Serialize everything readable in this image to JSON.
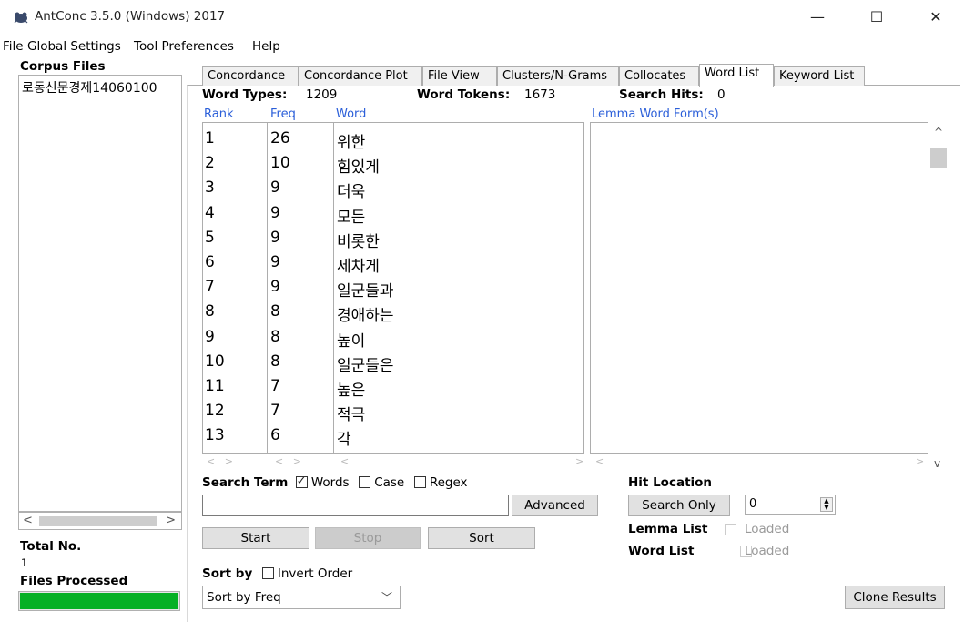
{
  "window": {
    "title": "AntConc 3.5.0 (Windows) 2017",
    "min_glyph": "—",
    "max_glyph": "☐",
    "close_glyph": "✕"
  },
  "menu": [
    "File",
    "Global Settings",
    "Tool Preferences",
    "Help"
  ],
  "left": {
    "corpus_label": "Corpus Files",
    "corpus_file": "로동신문경제14060100",
    "total_label": "Total No.",
    "total_value": "1",
    "processed_label": "Files Processed",
    "progress": 1.0,
    "progress_color": "#06b025",
    "scroll_left": "<",
    "scroll_right": ">"
  },
  "tabs": [
    {
      "label": "Concordance"
    },
    {
      "label": "Concordance Plot"
    },
    {
      "label": "File View"
    },
    {
      "label": "Clusters/N-Grams"
    },
    {
      "label": "Collocates"
    },
    {
      "label": "Word List",
      "active": true
    },
    {
      "label": "Keyword List"
    }
  ],
  "stats": {
    "types_label": "Word Types:",
    "types_value": "1209",
    "tokens_label": "Word Tokens:",
    "tokens_value": "1673",
    "hits_label": "Search Hits:",
    "hits_value": "0"
  },
  "columns": {
    "rank": "Rank",
    "freq": "Freq",
    "word": "Word",
    "lemma": "Lemma Word Form(s)",
    "header_color": "#2b5fd9"
  },
  "rows": [
    {
      "rank": "1",
      "freq": "26",
      "word": "위한"
    },
    {
      "rank": "2",
      "freq": "10",
      "word": "힘있게"
    },
    {
      "rank": "3",
      "freq": "9",
      "word": "더욱"
    },
    {
      "rank": "4",
      "freq": "9",
      "word": "모든"
    },
    {
      "rank": "5",
      "freq": "9",
      "word": "비롯한"
    },
    {
      "rank": "6",
      "freq": "9",
      "word": "세차게"
    },
    {
      "rank": "7",
      "freq": "9",
      "word": "일군들과"
    },
    {
      "rank": "8",
      "freq": "8",
      "word": "경애하는"
    },
    {
      "rank": "9",
      "freq": "8",
      "word": "높이"
    },
    {
      "rank": "10",
      "freq": "8",
      "word": "일군들은"
    },
    {
      "rank": "11",
      "freq": "7",
      "word": "높은"
    },
    {
      "rank": "12",
      "freq": "7",
      "word": "적극"
    },
    {
      "rank": "13",
      "freq": "6",
      "word": "각"
    }
  ],
  "search": {
    "term_label": "Search Term",
    "words_label": "Words",
    "words_checked": true,
    "case_label": "Case",
    "case_checked": false,
    "regex_label": "Regex",
    "regex_checked": false,
    "input_value": "",
    "advanced_label": "Advanced",
    "start_label": "Start",
    "stop_label": "Stop",
    "sort_label": "Sort"
  },
  "hit_location": {
    "label": "Hit Location",
    "search_only_label": "Search Only",
    "spin_value": "0"
  },
  "lists": {
    "lemma_label": "Lemma List",
    "word_label": "Word List",
    "loaded_text": "Loaded"
  },
  "sort": {
    "label": "Sort by",
    "invert_label": "Invert Order",
    "invert_checked": false,
    "selected": "Sort by Freq"
  },
  "clone_label": "Clone Results"
}
